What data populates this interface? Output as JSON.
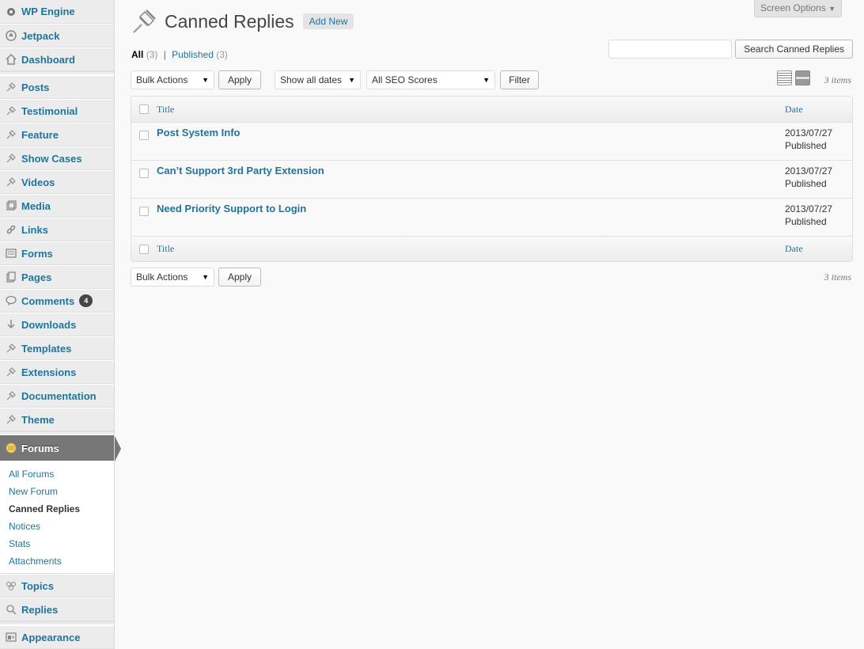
{
  "sidebar": {
    "items": [
      {
        "label": "WP Engine",
        "icon": "gear-icon"
      },
      {
        "label": "Jetpack",
        "icon": "jetpack-icon"
      },
      {
        "label": "Dashboard",
        "icon": "home-icon"
      },
      {
        "label": "Posts",
        "icon": "pin-icon"
      },
      {
        "label": "Testimonial",
        "icon": "pin-icon"
      },
      {
        "label": "Feature",
        "icon": "pin-icon"
      },
      {
        "label": "Show Cases",
        "icon": "pin-icon"
      },
      {
        "label": "Videos",
        "icon": "pin-icon"
      },
      {
        "label": "Media",
        "icon": "media-icon"
      },
      {
        "label": "Links",
        "icon": "link-icon"
      },
      {
        "label": "Forms",
        "icon": "forms-icon"
      },
      {
        "label": "Pages",
        "icon": "pages-icon"
      },
      {
        "label": "Comments",
        "icon": "comment-icon",
        "badge": "4"
      },
      {
        "label": "Downloads",
        "icon": "download-icon"
      },
      {
        "label": "Templates",
        "icon": "pin-icon"
      },
      {
        "label": "Extensions",
        "icon": "pin-icon"
      },
      {
        "label": "Documentation",
        "icon": "pin-icon"
      },
      {
        "label": "Theme",
        "icon": "pin-icon"
      }
    ],
    "forums": {
      "label": "Forums",
      "icon": "forums-icon",
      "submenu": [
        "All Forums",
        "New Forum",
        "Canned Replies",
        "Notices",
        "Stats",
        "Attachments"
      ]
    },
    "after": [
      {
        "label": "Topics",
        "icon": "topics-icon"
      },
      {
        "label": "Replies",
        "icon": "replies-icon"
      },
      {
        "label": "Appearance",
        "icon": "appearance-icon"
      }
    ]
  },
  "header": {
    "screen_options": "Screen Options",
    "title": "Canned Replies",
    "add_new": "Add New"
  },
  "filters": {
    "all_label": "All",
    "all_count": "(3)",
    "separator": "|",
    "published_label": "Published",
    "published_count": "(3)"
  },
  "search": {
    "placeholder": "",
    "button": "Search Canned Replies"
  },
  "tablenav_top": {
    "bulk_actions": "Bulk Actions",
    "apply": "Apply",
    "dates": "Show all dates",
    "seo": "All SEO Scores",
    "filter": "Filter",
    "items": "3 items"
  },
  "table": {
    "columns": [
      "Title",
      "Date"
    ],
    "rows": [
      {
        "title": "Post System Info",
        "date": "2013/07/27",
        "status": "Published"
      },
      {
        "title": "Can’t Support 3rd Party Extension",
        "date": "2013/07/27",
        "status": "Published"
      },
      {
        "title": "Need Priority Support to Login",
        "date": "2013/07/27",
        "status": "Published"
      }
    ]
  },
  "tablenav_bottom": {
    "bulk_actions": "Bulk Actions",
    "apply": "Apply",
    "items": "3 items"
  }
}
